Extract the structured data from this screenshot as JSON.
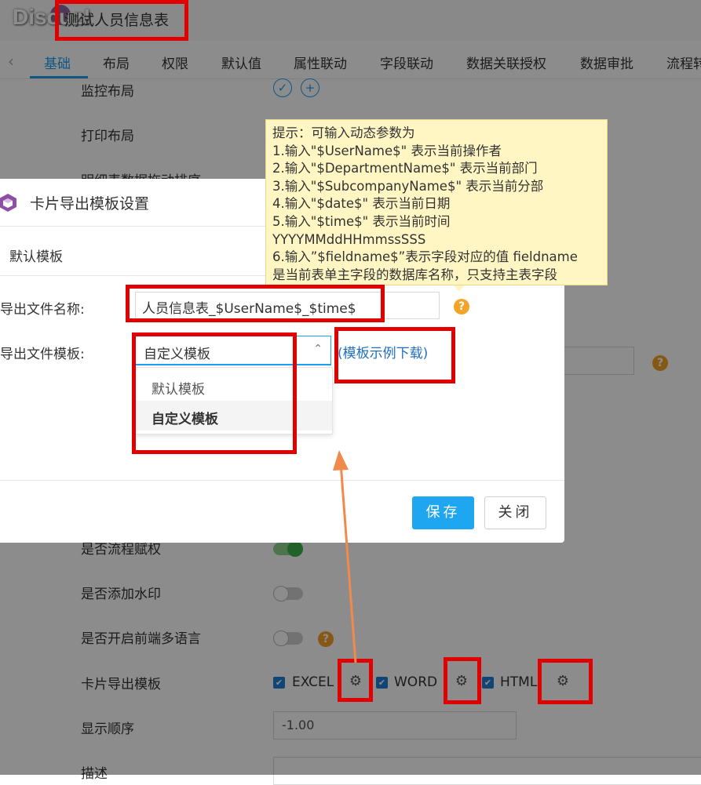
{
  "header": {
    "logo": "Discuz!",
    "title": "测试人员信息表"
  },
  "tabs": [
    {
      "label": "基础"
    },
    {
      "label": "布局"
    },
    {
      "label": "权限"
    },
    {
      "label": "默认值"
    },
    {
      "label": "属性联动"
    },
    {
      "label": "字段联动"
    },
    {
      "label": "数据关联授权"
    },
    {
      "label": "数据审批"
    },
    {
      "label": "流程转"
    }
  ],
  "bg_rows": {
    "monitor_layout": "监控布局",
    "print_layout": "打印布局",
    "detail_sort": "明细表数据拖动排序",
    "flow_auth": "是否流程赋权",
    "watermark": "是否添加水印",
    "multilang": "是否开启前端多语言",
    "card_export": "卡片导出模板",
    "display_order": "显示顺序",
    "description": "描述",
    "display_order_value": "-1.00",
    "excel": "EXCEL",
    "word": "WORD",
    "html": "HTML"
  },
  "modal": {
    "title": "卡片导出模板设置",
    "tab": "默认模板",
    "file_name_label": "导出文件名称:",
    "file_name_value": "人员信息表_$UserName$_$time$",
    "template_label": "导出文件模板:",
    "template_value": "自定义模板",
    "options": [
      "默认模板",
      "自定义模板"
    ],
    "link_open": "(",
    "link_text": "模板示例下载",
    "link_close": ")",
    "save_label": "保存",
    "close_label": "关闭"
  },
  "tooltip": {
    "lines": [
      "提示：可输入动态参数为",
      "1.输入\"$UserName$\" 表示当前操作者",
      "2.输入\"$DepartmentName$\" 表示当前部门",
      "3.输入\"$SubcompanyName$\" 表示当前分部",
      "4.输入\"$date$\" 表示当前日期",
      "5.输入\"$time$\" 表示当前时间",
      "YYYYMMddHHmmssSSS",
      "6.输入”$fieldname$”表示字段对应的值 fieldname",
      "是当前表单主字段的数据库名称，只支持主表字段"
    ]
  },
  "icons": {
    "help": "?",
    "gear": "⚙",
    "check": "✓",
    "plus": "+",
    "caret_up": "⌃",
    "prev": "‹",
    "checkbox": "✔"
  },
  "colors": {
    "accent": "#1ea0f0",
    "save": "#1ea6f0",
    "help": "#f3a327",
    "annotation": "#e00000",
    "arrow": "#f08a4b",
    "tooltip_bg": "#fff6c4"
  }
}
